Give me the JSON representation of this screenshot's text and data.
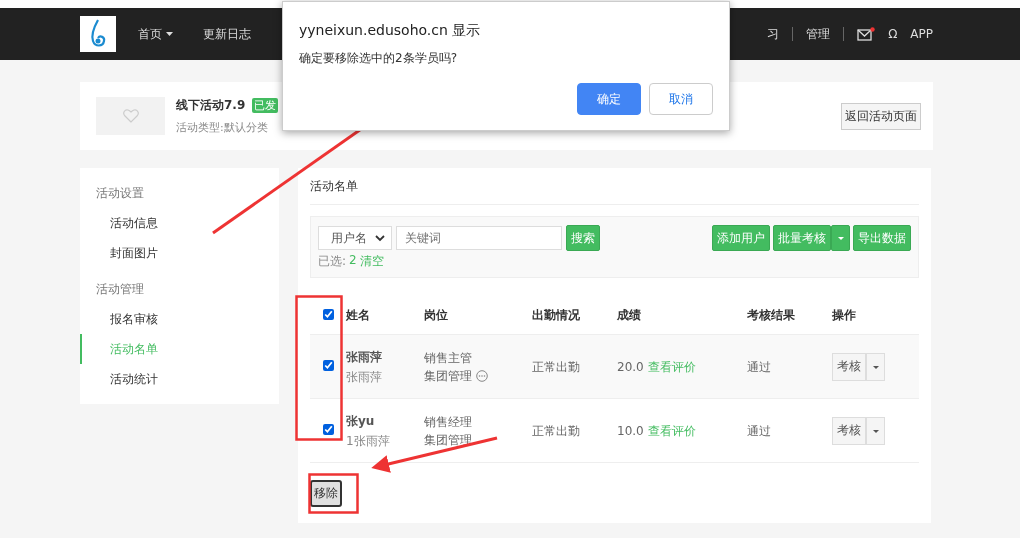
{
  "navbar": {
    "left": [
      {
        "label": "首页",
        "caret": true
      },
      {
        "label": "更新日志",
        "caret": false
      }
    ],
    "right": [
      {
        "kind": "text",
        "label": "习"
      },
      {
        "kind": "divider"
      },
      {
        "kind": "text",
        "label": "管理"
      },
      {
        "kind": "divider"
      },
      {
        "kind": "mail",
        "unread": true
      },
      {
        "kind": "text",
        "label": "Ω"
      },
      {
        "kind": "text",
        "label": "APP"
      }
    ]
  },
  "activity": {
    "title": "线下活动7.9",
    "status": "已发",
    "type": "活动类型:默认分类",
    "back_button": "返回活动页面"
  },
  "sidebar": {
    "groups": [
      {
        "heading": "活动设置",
        "items": [
          {
            "label": "活动信息",
            "selected": false
          },
          {
            "label": "封面图片",
            "selected": false
          }
        ]
      },
      {
        "heading": "活动管理",
        "items": [
          {
            "label": "报名审核",
            "selected": false
          },
          {
            "label": "活动名单",
            "selected": true
          },
          {
            "label": "活动统计",
            "selected": false
          }
        ]
      }
    ]
  },
  "panel": {
    "title": "活动名单",
    "search_type": "用户名",
    "search": {
      "placeholder": "关键词"
    },
    "search_button": "搜索",
    "selected_label": "已选:",
    "selected_count": "2",
    "clear_link": "清空",
    "actions": [
      "添加用户",
      "批量考核",
      "导出数据"
    ]
  },
  "table": {
    "select_all": true,
    "columns": [
      "姓名",
      "岗位",
      "出勤情况",
      "成绩",
      "考核结果",
      "操作"
    ],
    "rows": [
      {
        "selected": true,
        "name": "张雨萍",
        "sub_name": "张雨萍",
        "position": "销售主管",
        "department": "集团管理",
        "more": true,
        "attendance": "正常出勤",
        "score": "20.0",
        "review_link": "查看评价",
        "result": "通过",
        "action": "考核"
      },
      {
        "selected": true,
        "name": "张yu",
        "sub_name": "1张雨萍",
        "position": "销售经理",
        "department": "集团管理",
        "more": false,
        "attendance": "正常出勤",
        "score": "10.0",
        "review_link": "查看评价",
        "result": "通过",
        "action": "考核"
      }
    ]
  },
  "remove_button": "移除",
  "dialog": {
    "title": "yyneixun.edusoho.cn 显示",
    "message": "确定要移除选中的2条学员吗?",
    "buttons": [
      {
        "label": "确定",
        "primary": true
      },
      {
        "label": "取消",
        "primary": false
      }
    ]
  }
}
